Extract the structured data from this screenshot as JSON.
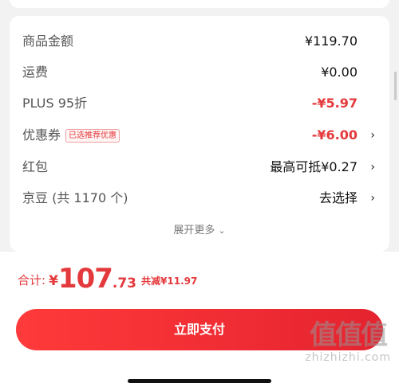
{
  "summary": {
    "rows": [
      {
        "label": "商品金额",
        "value": "¥119.70"
      },
      {
        "label": "运费",
        "value": "¥0.00"
      },
      {
        "label": "PLUS 95折",
        "value": "-¥5.97"
      },
      {
        "label": "优惠券",
        "tag": "已选推荐优惠",
        "value": "-¥6.00",
        "chevron": "›"
      },
      {
        "label": "红包",
        "value": "最高可抵¥0.27",
        "chevron": "›"
      },
      {
        "label": "京豆 (共 1170 个)",
        "value": "去选择",
        "chevron": "›"
      }
    ],
    "more_label": "展开更多",
    "more_icon": "⌄"
  },
  "footer": {
    "total_label": "合计:",
    "currency": "¥",
    "total_integer": "107",
    "total_decimal": ".73",
    "savings": "共减¥11.97",
    "pay_button": "立即支付"
  },
  "watermark": {
    "big": "值值值",
    "small": "zhizhizhi.com"
  },
  "colors": {
    "accent": "#e4393c",
    "button_start": "#ff3a3a",
    "button_end": "#e5232f"
  }
}
